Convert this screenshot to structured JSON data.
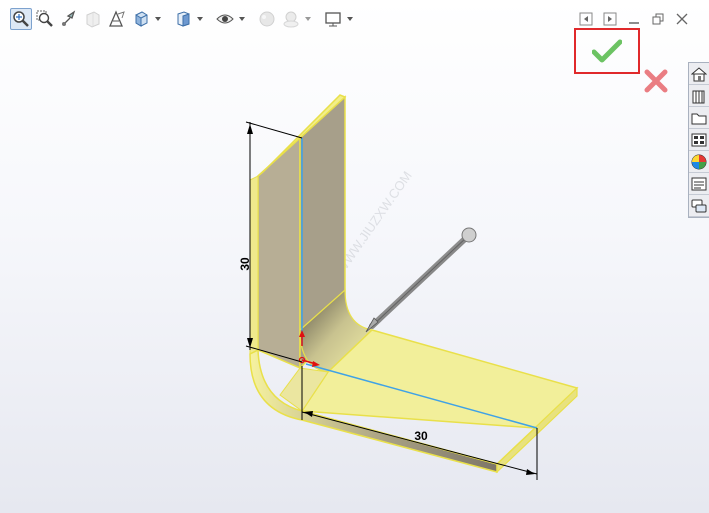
{
  "toolbar": {
    "buttons": [
      {
        "icon": "zoom-to-fit-icon",
        "active": true
      },
      {
        "icon": "zoom-to-area-icon"
      },
      {
        "icon": "previous-view-icon"
      },
      {
        "icon": "section-view-icon",
        "disabled": true
      },
      {
        "icon": "dynamic-annotation-view-icon"
      },
      {
        "icon": "view-orientation-icon",
        "dropdown": true
      },
      {
        "icon": "display-style-icon",
        "dropdown": true
      },
      {
        "icon": "hide-show-items-icon",
        "dropdown": true
      },
      {
        "icon": "edit-appearance-icon",
        "disabled": true
      },
      {
        "icon": "apply-scene-icon",
        "disabled": true,
        "dropdown": true
      },
      {
        "icon": "view-settings-icon",
        "dropdown": true
      }
    ]
  },
  "window_controls": [
    "previous-icon",
    "next-icon",
    "minimize-icon",
    "restore-icon",
    "close-icon"
  ],
  "confirm_corner": {
    "ok_icon": "ok-check-icon",
    "cancel_icon": "cancel-x-icon",
    "ok_color": "#52b848",
    "cancel_color": "#e5535a",
    "highlight_color": "#e0292b"
  },
  "task_pane": [
    "home-icon",
    "design-library-icon",
    "file-explorer-icon",
    "view-palette-icon",
    "appearances-icon",
    "custom-properties-icon",
    "forum-icon"
  ],
  "dimensions": {
    "vertical": "30",
    "horizontal": "30"
  },
  "model_colors": {
    "face_highlight": "#f2ef8a",
    "edge_highlight": "#e9e04a",
    "sketch_line": "#3fa2e6"
  }
}
